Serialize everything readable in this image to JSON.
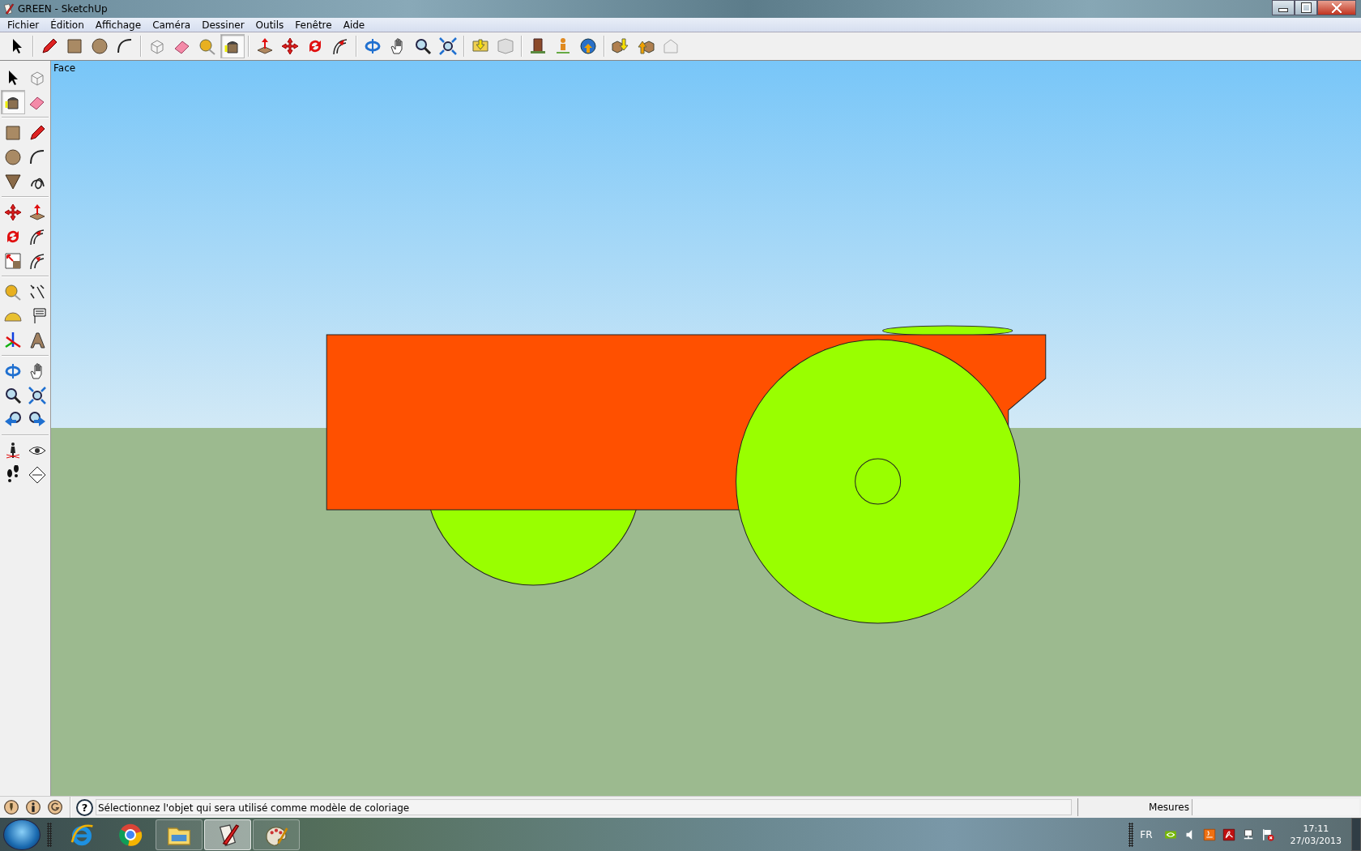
{
  "window": {
    "title": "GREEN - SketchUp"
  },
  "menu": [
    "Fichier",
    "Édition",
    "Affichage",
    "Caméra",
    "Dessiner",
    "Outils",
    "Fenêtre",
    "Aide"
  ],
  "toolbar": [
    [
      {
        "kind": "select",
        "selected": false
      }
    ],
    [
      {
        "kind": "pencil",
        "selected": false
      },
      {
        "kind": "rectangle",
        "selected": false
      },
      {
        "kind": "circle",
        "selected": false
      },
      {
        "kind": "arc",
        "selected": false
      }
    ],
    [
      {
        "kind": "component",
        "selected": false
      },
      {
        "kind": "eraser",
        "selected": false
      },
      {
        "kind": "tape",
        "selected": false
      },
      {
        "kind": "paint",
        "selected": true
      }
    ],
    [
      {
        "kind": "pushpull",
        "selected": false
      },
      {
        "kind": "move",
        "selected": false
      },
      {
        "kind": "rotate",
        "selected": false
      },
      {
        "kind": "followme",
        "selected": false
      }
    ],
    [
      {
        "kind": "orbit",
        "selected": false
      },
      {
        "kind": "pan",
        "selected": false
      },
      {
        "kind": "zoom",
        "selected": false
      },
      {
        "kind": "zoomext",
        "selected": false
      }
    ],
    [
      {
        "kind": "folderdown",
        "selected": false
      },
      {
        "kind": "greyshape",
        "selected": false
      }
    ],
    [
      {
        "kind": "building",
        "selected": false
      },
      {
        "kind": "figure",
        "selected": false
      },
      {
        "kind": "globe",
        "selected": false
      }
    ],
    [
      {
        "kind": "boxesdown",
        "selected": false
      },
      {
        "kind": "boxesup",
        "selected": false
      },
      {
        "kind": "greyhouse",
        "selected": false
      }
    ]
  ],
  "tool_palette": [
    [
      {
        "kind": "select",
        "selected": false
      },
      {
        "kind": "component",
        "selected": false
      },
      {
        "kind": "paint",
        "selected": true
      },
      {
        "kind": "eraser",
        "selected": false
      }
    ],
    [
      {
        "kind": "rectangle",
        "selected": false
      },
      {
        "kind": "pencil",
        "selected": false
      },
      {
        "kind": "circle",
        "selected": false
      },
      {
        "kind": "arc",
        "selected": false
      },
      {
        "kind": "polygon",
        "selected": false
      },
      {
        "kind": "freehand",
        "selected": false
      }
    ],
    [
      {
        "kind": "move",
        "selected": false
      },
      {
        "kind": "pushpull",
        "selected": false
      },
      {
        "kind": "rotate",
        "selected": false
      },
      {
        "kind": "followme",
        "selected": false
      },
      {
        "kind": "scale",
        "selected": false
      },
      {
        "kind": "offset",
        "selected": false
      }
    ],
    [
      {
        "kind": "tape",
        "selected": false
      },
      {
        "kind": "dimension",
        "selected": false
      },
      {
        "kind": "protractor",
        "selected": false
      },
      {
        "kind": "text",
        "selected": false
      },
      {
        "kind": "axes",
        "selected": false
      },
      {
        "kind": "text3d",
        "selected": false
      }
    ],
    [
      {
        "kind": "orbit",
        "selected": false
      },
      {
        "kind": "pan",
        "selected": false
      },
      {
        "kind": "zoom",
        "selected": false
      },
      {
        "kind": "zoomext",
        "selected": false
      },
      {
        "kind": "prev",
        "selected": false
      },
      {
        "kind": "next",
        "selected": false
      }
    ],
    [
      {
        "kind": "position",
        "selected": false
      },
      {
        "kind": "lookaround",
        "selected": false
      },
      {
        "kind": "walk",
        "selected": false
      },
      {
        "kind": "section",
        "selected": false
      }
    ]
  ],
  "viewport": {
    "label": "Face"
  },
  "status_bar": {
    "icons": [
      {
        "kind": "pin"
      },
      {
        "kind": "person"
      },
      {
        "kind": "gcircle"
      }
    ],
    "help": "?",
    "message": "Sélectionnez l'objet qui sera utilisé comme modèle de coloriage",
    "measurements_label": "Mesures"
  },
  "taskbar": {
    "apps": [
      {
        "kind": "ie",
        "selected": false
      },
      {
        "kind": "chrome",
        "selected": false
      },
      {
        "kind": "explorer",
        "selected": false
      },
      {
        "kind": "sketchup",
        "selected": true
      },
      {
        "kind": "palette",
        "selected": false
      }
    ],
    "language": "FR",
    "tray": [
      {
        "kind": "nvidia"
      },
      {
        "kind": "speaker"
      },
      {
        "kind": "java"
      },
      {
        "kind": "pdf"
      },
      {
        "kind": "network"
      },
      {
        "kind": "flag"
      }
    ],
    "time": "17:11",
    "date": "27/03/2013"
  }
}
